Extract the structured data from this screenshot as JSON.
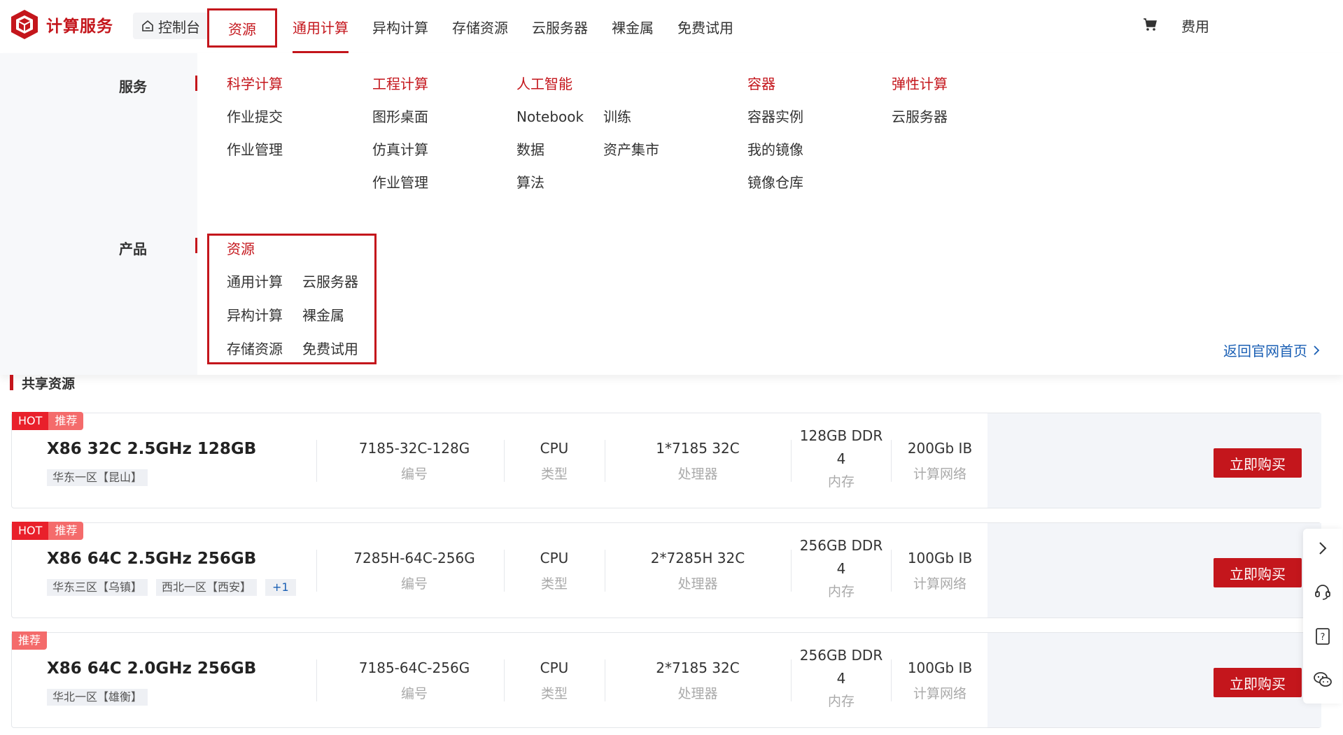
{
  "header": {
    "logo_text": "计算服务",
    "console_label": "控制台",
    "resource_label": "资源",
    "nav": [
      "通用计算",
      "异构计算",
      "存储资源",
      "云服务器",
      "裸金属",
      "免费试用"
    ],
    "fee_label": "费用",
    "accent_color": "#c4161c"
  },
  "menu": {
    "services_label": "服务",
    "products_label": "产品",
    "columns": [
      {
        "title": "科学计算",
        "items": [
          "作业提交",
          "作业管理"
        ]
      },
      {
        "title": "工程计算",
        "items": [
          "图形桌面",
          "仿真计算",
          "作业管理"
        ]
      },
      {
        "title": "人工智能",
        "items": [
          "Notebook",
          "数据",
          "算法"
        ],
        "items2": [
          "训练",
          "资产集市"
        ]
      },
      {
        "title": "容器",
        "items": [
          "容器实例",
          "我的镜像",
          "镜像仓库"
        ]
      },
      {
        "title": "弹性计算",
        "items": [
          "云服务器"
        ]
      }
    ],
    "products": {
      "title": "资源",
      "left": [
        "通用计算",
        "异构计算",
        "存储资源"
      ],
      "right": [
        "云服务器",
        "裸金属",
        "免费试用"
      ]
    },
    "back_link": "返回官网首页"
  },
  "section_title": "共享资源",
  "cards": [
    {
      "tags": [
        "HOT",
        "推荐"
      ],
      "name": "X86 32C 2.5GHz 128GB",
      "regions": [
        "华东一区【昆山】"
      ],
      "code": "7185-32C-128G",
      "code_label": "编号",
      "type": "CPU",
      "type_label": "类型",
      "cpu": "1*7185 32C",
      "cpu_label": "处理器",
      "mem_line1": "128GB DDR",
      "mem_line2": "4",
      "mem_label": "内存",
      "net": "200Gb IB",
      "net_label": "计算网络",
      "buy": "立即购买"
    },
    {
      "tags": [
        "HOT",
        "推荐"
      ],
      "name": "X86 64C 2.5GHz 256GB",
      "regions": [
        "华东三区【乌镇】",
        "西北一区【西安】"
      ],
      "more": "+1",
      "code": "7285H-64C-256G",
      "code_label": "编号",
      "type": "CPU",
      "type_label": "类型",
      "cpu": "2*7285H 32C",
      "cpu_label": "处理器",
      "mem_line1": "256GB DDR",
      "mem_line2": "4",
      "mem_label": "内存",
      "net": "100Gb IB",
      "net_label": "计算网络",
      "buy": "立即购买"
    },
    {
      "tags": [
        "推荐"
      ],
      "name": "X86 64C 2.0GHz 256GB",
      "regions": [
        "华北一区【雄衡】"
      ],
      "code": "7185-64C-256G",
      "code_label": "编号",
      "type": "CPU",
      "type_label": "类型",
      "cpu": "2*7185 32C",
      "cpu_label": "处理器",
      "mem_line1": "256GB DDR",
      "mem_line2": "4",
      "mem_label": "内存",
      "net": "100Gb IB",
      "net_label": "计算网络",
      "buy": "立即购买"
    }
  ],
  "sidebar_icons": [
    "chevron-right-icon",
    "headset-icon",
    "help-doc-icon",
    "wechat-icon"
  ]
}
